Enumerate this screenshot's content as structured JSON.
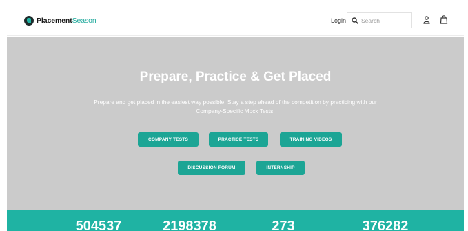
{
  "header": {
    "brand_primary": "Placement",
    "brand_accent": "Season",
    "login_label": "Login",
    "search_placeholder": "Search",
    "icons": [
      "search-icon",
      "user-icon",
      "cart-icon"
    ]
  },
  "hero": {
    "title": "Prepare, Practice & Get Placed",
    "subtitle": "Prepare and get placed in the easiest way possible. Stay a step ahead of the competition by practicing with our Company-Specific Mock Tests.",
    "buttons": [
      {
        "label": "COMPANY TESTS"
      },
      {
        "label": "PRACTICE TESTS"
      },
      {
        "label": "TRAINING VIDEOS"
      },
      {
        "label": "DISCUSSION FORUM"
      },
      {
        "label": "INTERNSHIP"
      }
    ]
  },
  "stats": [
    "504537",
    "2198378",
    "273",
    "376282"
  ],
  "colors": {
    "accent": "#1fb3a3",
    "button": "#1ca595",
    "hero_bg": "#cbcbcb"
  }
}
